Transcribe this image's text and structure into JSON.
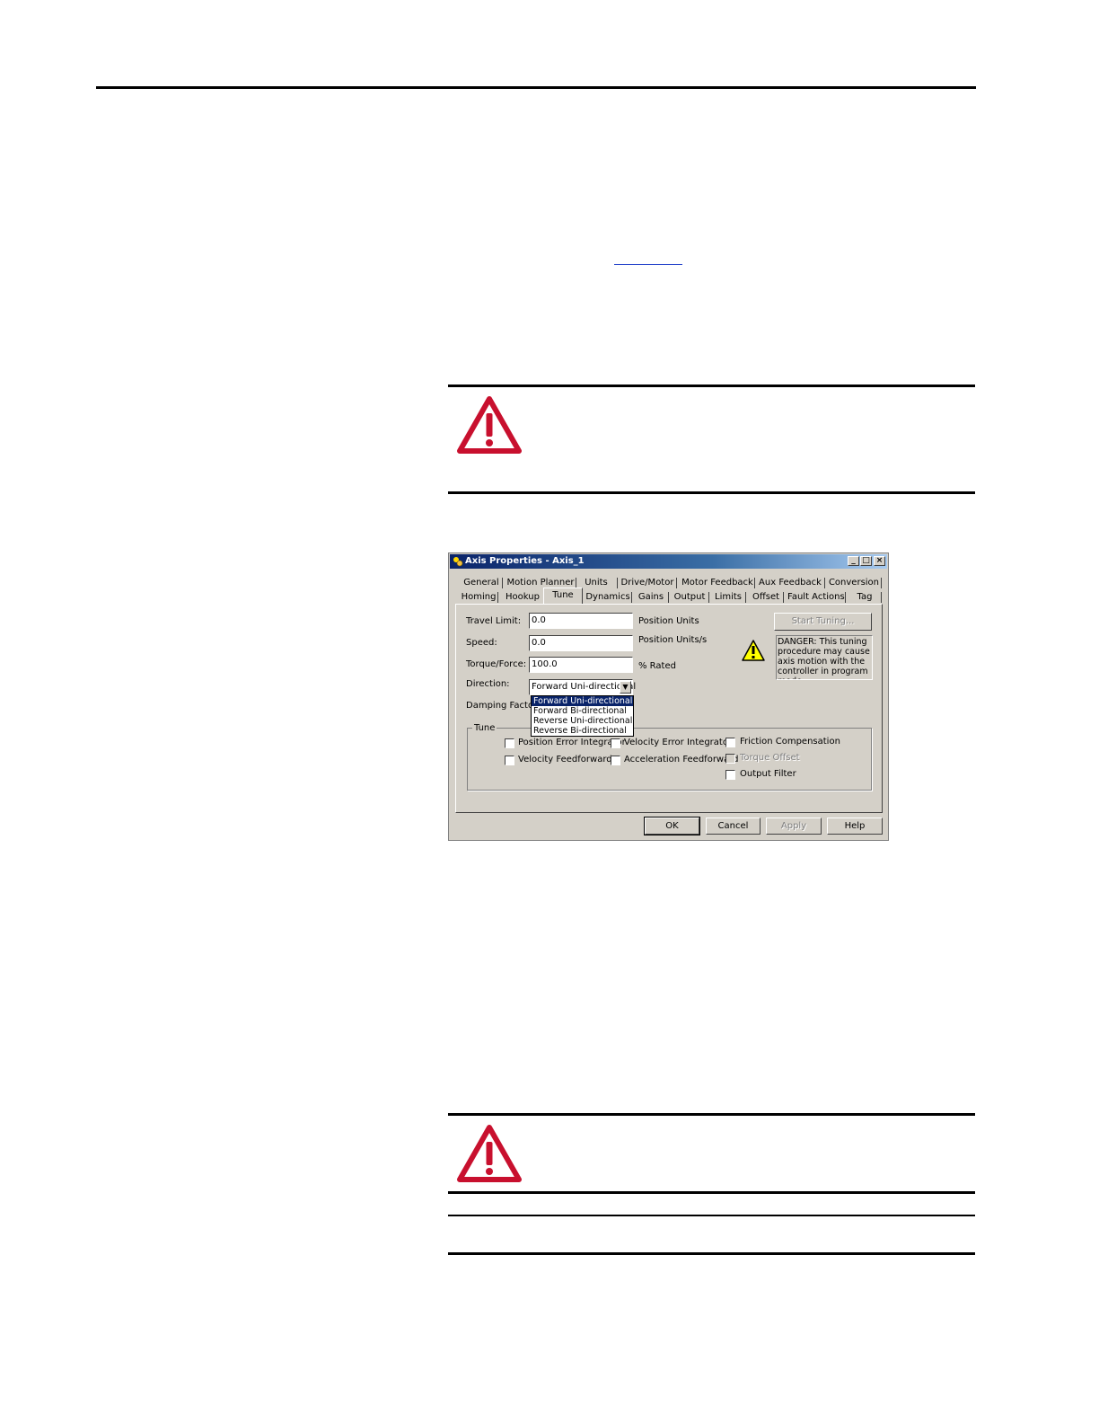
{
  "dialog": {
    "title": "Axis Properties - Axis_1",
    "title_buttons": {
      "minimize": "_",
      "maximize": "□",
      "close": "×"
    },
    "tabs_row1": [
      "General",
      "Motion Planner",
      "Units",
      "Drive/Motor",
      "Motor Feedback",
      "Aux Feedback",
      "Conversion"
    ],
    "tabs_row2": [
      "Homing",
      "Hookup",
      "Tune",
      "Dynamics",
      "Gains",
      "Output",
      "Limits",
      "Offset",
      "Fault Actions",
      "Tag"
    ],
    "active_tab": "Tune",
    "fields": {
      "travel_limit": {
        "label": "Travel Limit:",
        "value": "0.0",
        "unit": "Position Units"
      },
      "speed": {
        "label": "Speed:",
        "value": "0.0",
        "unit": "Position Units/s"
      },
      "torque_force": {
        "label": "Torque/Force:",
        "value": "100.0",
        "unit": "% Rated"
      },
      "direction": {
        "label": "Direction:",
        "value": "Forward Uni-directional"
      },
      "damping_factor": {
        "label": "Damping Factor:"
      }
    },
    "direction_options": [
      "Forward Uni-directional",
      "Forward Bi-directional",
      "Reverse Uni-directional",
      "Reverse Bi-directional"
    ],
    "start_tuning_label": "Start Tuning...",
    "danger_text": "DANGER: This tuning procedure may cause axis motion with the controller in program mode.",
    "tune_group": {
      "label": "Tune",
      "checkboxes": {
        "position_error_integrator": "Position Error Integrator",
        "velocity_error_integrator": "Velocity Error Integrator",
        "friction_compensation": "Friction Compensation",
        "velocity_feedforward": "Velocity Feedforward",
        "acceleration_feedforward": "Acceleration Feedforward",
        "torque_offset": "Torque Offset",
        "output_filter": "Output Filter"
      }
    },
    "buttons": {
      "ok": "OK",
      "cancel": "Cancel",
      "apply": "Apply",
      "help": "Help"
    }
  },
  "colors": {
    "warning_red": "#c8102e",
    "dialog_face": "#d4d0c8",
    "titlebar_blue": "#0a246a",
    "selection_blue": "#0a246a",
    "warning_yellow": "#ffff00"
  }
}
